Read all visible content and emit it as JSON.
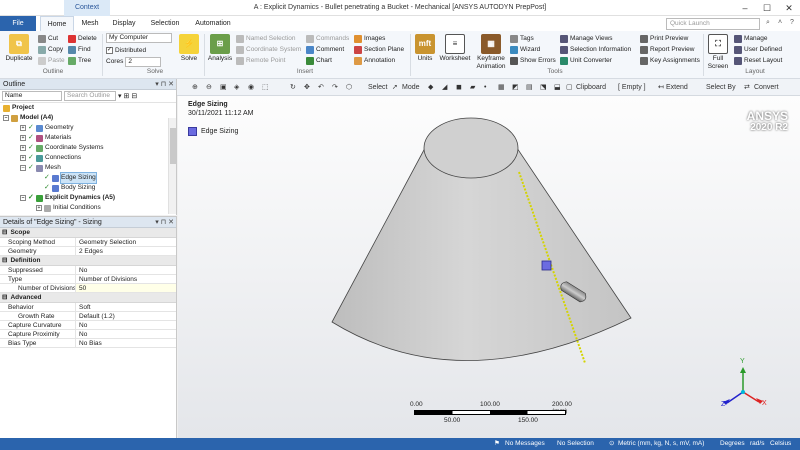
{
  "titlebar": {
    "context_tab": "Context",
    "title": "A : Explicit Dynamics - Bullet penetrating a Bucket - Mechanical [ANSYS AUTODYN PrepPost]",
    "min": "–",
    "max": "☐",
    "close": "✕"
  },
  "tabs": {
    "file": "File",
    "home": "Home",
    "mesh": "Mesh",
    "display": "Display",
    "selection": "Selection",
    "automation": "Automation",
    "quick_launch_placeholder": "Quick Launch"
  },
  "ribbon": {
    "outline": {
      "duplicate": "Duplicate",
      "cut": "Cut",
      "copy": "Copy",
      "paste": "Paste",
      "delete": "Delete",
      "find": "Find",
      "tree": "Tree",
      "group": "Outline"
    },
    "solve": {
      "computer": "My Computer",
      "distributed": "Distributed",
      "cores_label": "Cores",
      "cores_value": "2",
      "solve": "Solve",
      "group": "Solve"
    },
    "insert": {
      "analysis": "Analysis",
      "named_selection": "Named Selection",
      "coordinate_system": "Coordinate System",
      "remote_point": "Remote Point",
      "commands": "Commands",
      "comment": "Comment",
      "chart": "Chart",
      "images": "Images",
      "section_plane": "Section Plane",
      "annotation": "Annotation",
      "group": "Insert"
    },
    "tools": {
      "units": "Units",
      "worksheet": "Worksheet",
      "keyframe": "Keyframe Animation",
      "tags": "Tags",
      "wizard": "Wizard",
      "show_errors": "Show Errors",
      "manage_views": "Manage Views",
      "selection_information": "Selection Information",
      "unit_converter": "Unit Converter",
      "print_preview": "Print Preview",
      "report_preview": "Report Preview",
      "key_assignments": "Key Assignments",
      "group": "Tools"
    },
    "layout": {
      "full_screen": "Full Screen",
      "manage": "Manage",
      "user_defined": "User Defined",
      "reset_layout": "Reset Layout",
      "group": "Layout"
    }
  },
  "toolbar": {
    "select": "Select",
    "mode": "Mode",
    "clipboard": "Clipboard",
    "empty": "[ Empty ]",
    "extend": "Extend",
    "select_by": "Select By",
    "convert": "Convert"
  },
  "outline": {
    "header": "Outline",
    "filter_label": "Name",
    "search_placeholder": "Search Outline",
    "tree": [
      {
        "label": "Project"
      },
      {
        "label": "Model (A4)"
      },
      {
        "label": "Geometry"
      },
      {
        "label": "Materials"
      },
      {
        "label": "Coordinate Systems"
      },
      {
        "label": "Connections"
      },
      {
        "label": "Mesh"
      },
      {
        "label": "Edge Sizing"
      },
      {
        "label": "Body Sizing"
      },
      {
        "label": "Explicit Dynamics (A5)"
      },
      {
        "label": "Initial Conditions"
      }
    ]
  },
  "details": {
    "header": "Details of \"Edge Sizing\" - Sizing",
    "sections": [
      {
        "title": "Scope",
        "rows": [
          {
            "k": "Scoping Method",
            "v": "Geometry Selection"
          },
          {
            "k": "Geometry",
            "v": "2 Edges"
          }
        ]
      },
      {
        "title": "Definition",
        "rows": [
          {
            "k": "Suppressed",
            "v": "No"
          },
          {
            "k": "Type",
            "v": "Number of Divisions"
          },
          {
            "k": "Number of Divisions",
            "v": "50"
          }
        ]
      },
      {
        "title": "Advanced",
        "rows": [
          {
            "k": "Behavior",
            "v": "Soft"
          },
          {
            "k": "Growth Rate",
            "v": "Default (1.2)"
          },
          {
            "k": "Capture Curvature",
            "v": "No"
          },
          {
            "k": "Capture Proximity",
            "v": "No"
          },
          {
            "k": "Bias Type",
            "v": "No Bias"
          }
        ]
      }
    ]
  },
  "viewport": {
    "title": "Edge Sizing",
    "date": "30/11/2021 11:12 AM",
    "legend": "Edge Sizing",
    "brand": "ANSYS",
    "version": "2020 R2",
    "scale": {
      "t0": "0.00",
      "t1": "100.00",
      "t2": "200.00 (mm)",
      "b1": "50.00",
      "b2": "150.00"
    },
    "triad": {
      "x": "X",
      "y": "Y",
      "z": "Z"
    }
  },
  "status": {
    "messages": "No Messages",
    "selection": "No Selection",
    "units": "Metric (mm, kg, N, s, mV, mA)",
    "degrees": "Degrees",
    "rads": "rad/s",
    "temp": "Celsius"
  },
  "colors": {
    "accent": "#2b64ad",
    "selection": "#6b6be0",
    "edge": "#d4d400"
  }
}
